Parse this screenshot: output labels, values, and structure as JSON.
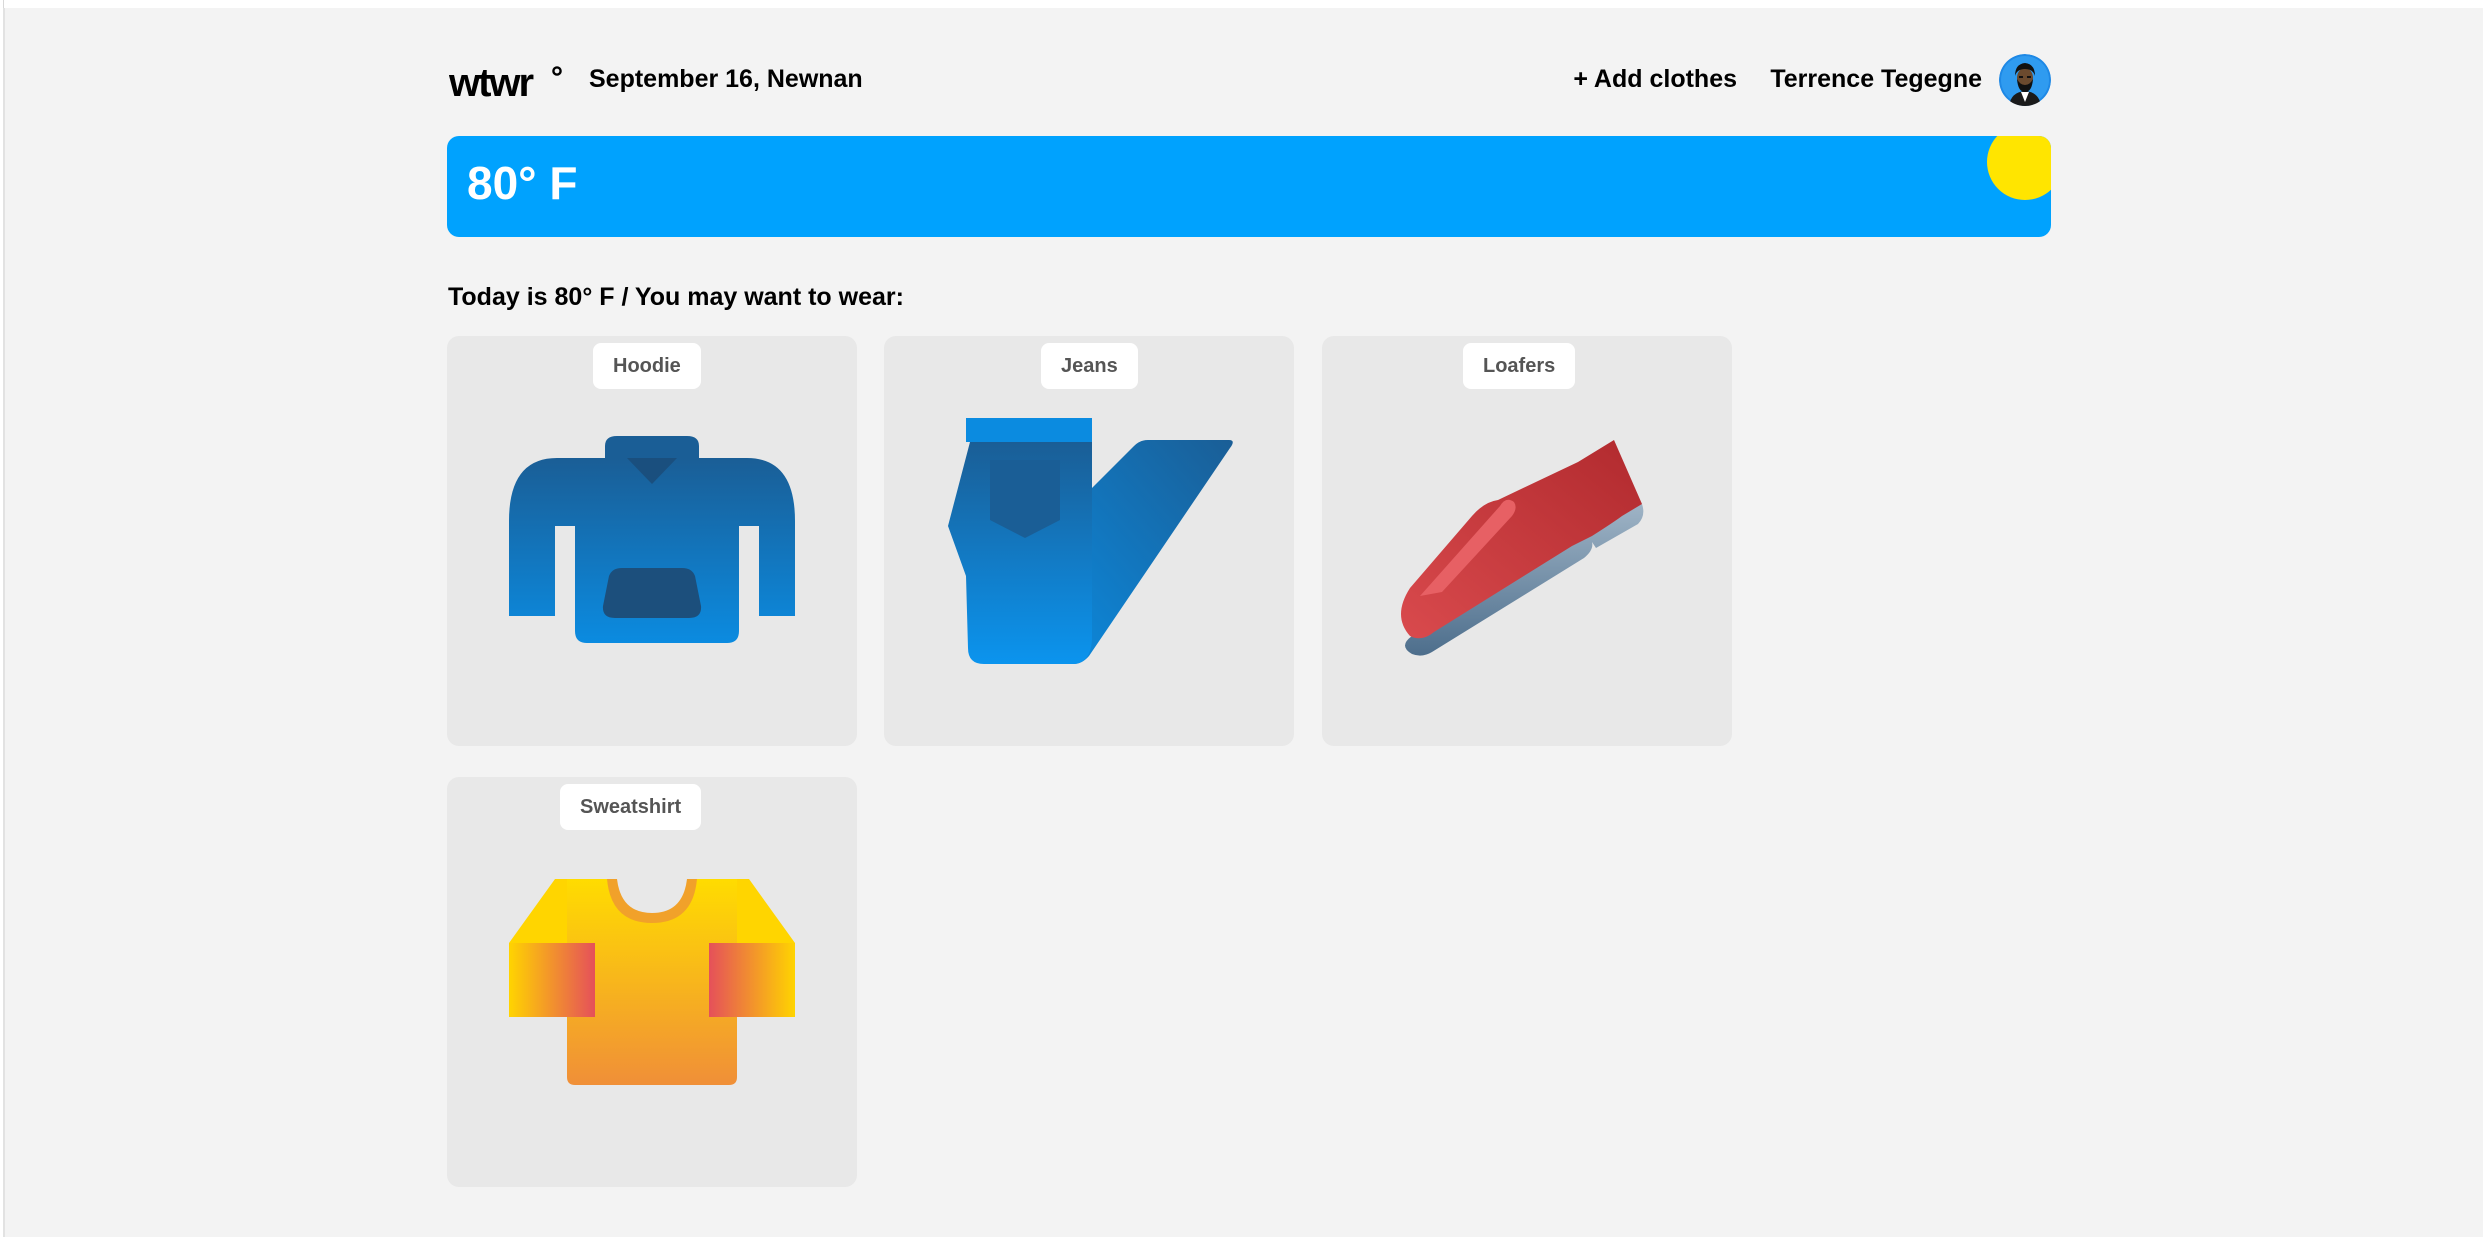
{
  "header": {
    "logo_text": "wtwr°",
    "date_location": "September 16, Newnan",
    "add_clothes_label": "+ Add clothes",
    "username": "Terrence Tegegne"
  },
  "weather": {
    "temperature": "80° F"
  },
  "main": {
    "suggestion_text": "Today is 80° F / You may want to wear:",
    "items": [
      {
        "name": "Hoodie",
        "icon": "hoodie-icon"
      },
      {
        "name": "Jeans",
        "icon": "jeans-icon"
      },
      {
        "name": "Loafers",
        "icon": "loafers-icon"
      },
      {
        "name": "Sweatshirt",
        "icon": "sweatshirt-icon"
      }
    ]
  },
  "colors": {
    "page_background": "#f3f3f3",
    "weather_banner": "#00a2fe",
    "sun": "#ffe500",
    "card_background": "#e8e8e8"
  }
}
